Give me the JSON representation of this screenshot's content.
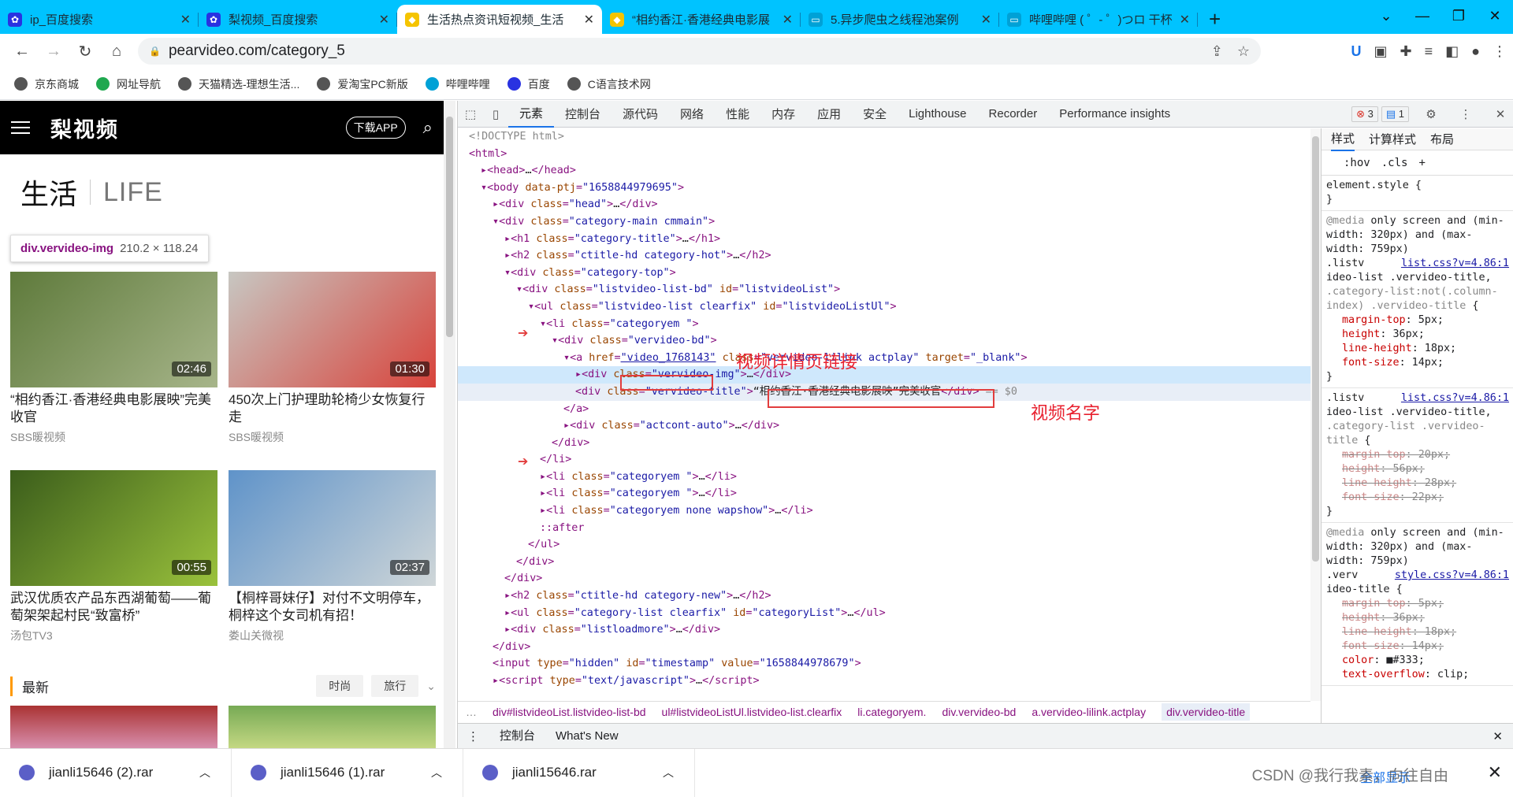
{
  "tabs": [
    {
      "title": "ip_百度搜索",
      "fav": "#2932e1",
      "icon": "baidu-paw-icon"
    },
    {
      "title": "梨视频_百度搜索",
      "fav": "#2932e1",
      "icon": "baidu-paw-icon"
    },
    {
      "title": "生活热点资讯短视频_生活",
      "fav": "#f5c400",
      "icon": "pear-logo-icon",
      "active": true
    },
    {
      "title": "“相约香江·香港经典电影展",
      "fav": "#f5c400",
      "icon": "pear-logo-icon"
    },
    {
      "title": "5.异步爬虫之线程池案例",
      "fav": "#00a1d6",
      "icon": "bilibili-tv-icon"
    },
    {
      "title": "哔哩哔哩 ( ゜- ゜)つロ 干杯",
      "fav": "#00a1d6",
      "icon": "bilibili-tv-icon"
    }
  ],
  "omnibox": {
    "url": "pearvideo.com/category_5"
  },
  "bookmarks": [
    "京东商城",
    "网址导航",
    "天猫精选-理想生活...",
    "爱淘宝PC新版",
    "哔哩哔哩",
    "百度",
    "C语言技术网"
  ],
  "site": {
    "logo": "梨视频",
    "download": "下载APP",
    "cat_cn": "生活",
    "cat_en": "LIFE",
    "tooltip_tag": "div.vervideo-img",
    "tooltip_size": "210.2 × 118.24",
    "cards": [
      {
        "title": "“相约香江·香港经典电影展映”完美收官",
        "src": "SBS暖视频",
        "dur": "02:46",
        "c1": "#5e7a3b",
        "c2": "#a7b58a"
      },
      {
        "title": "450次上门护理助轮椅少女恢复行走",
        "src": "SBS暖视频",
        "dur": "01:30",
        "c1": "#c7c7c2",
        "c2": "#d8433b"
      },
      {
        "title": "武汉优质农产品东西湖葡萄——葡萄架架起村民“致富桥”",
        "src": "汤包TV3",
        "dur": "00:55",
        "c1": "#3b5d1b",
        "c2": "#9ac23c"
      },
      {
        "title": "【桐梓哥妹仔】对付不文明停车，桐梓这个女司机有招！",
        "src": "娄山关微视",
        "dur": "02:37",
        "c1": "#5f93c9",
        "c2": "#cfd6d8"
      }
    ],
    "latest": "最新",
    "pills": [
      "时尚",
      "旅行"
    ]
  },
  "devtools": {
    "tabs": [
      "元素",
      "控制台",
      "源代码",
      "网络",
      "性能",
      "内存",
      "应用",
      "安全",
      "Lighthouse",
      "Recorder",
      "Performance insights"
    ],
    "errors": "3",
    "messages": "1",
    "note1": "视频详情页链接",
    "note2": "视频名字",
    "crumbs": [
      "div#listvideoList.listvideo-list-bd",
      "ul#listvideoListUl.listvideo-list.clearfix",
      "li.categoryem.",
      "div.vervideo-bd",
      "a.vervideo-lilink.actplay",
      "div.vervideo-title"
    ],
    "drawer": [
      "控制台",
      "What's New"
    ],
    "style_tabs": [
      "样式",
      "计算样式",
      "布局"
    ],
    "filters": [
      ":hov",
      ".cls"
    ]
  },
  "downloads": [
    "jianli15646 (2).rar",
    "jianli15646 (1).rar",
    "jianli15646.rar"
  ],
  "show_all": "全部显示",
  "watermark": "CSDN @我行我素，向往自由"
}
